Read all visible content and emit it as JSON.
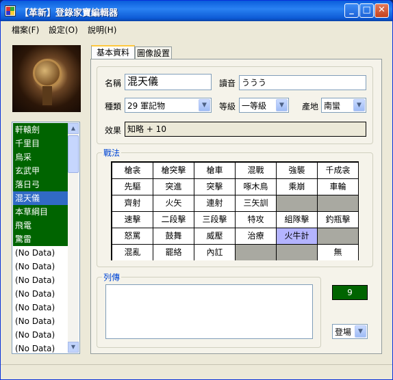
{
  "window": {
    "title": "【革新】登錄家寶編輯器"
  },
  "menu": [
    "檔案(F)",
    "設定(O)",
    "說明(H)"
  ],
  "list": {
    "items": [
      {
        "label": "軒轅劍",
        "style": "green"
      },
      {
        "label": "千里目",
        "style": "green"
      },
      {
        "label": "烏采",
        "style": "green"
      },
      {
        "label": "玄武甲",
        "style": "green"
      },
      {
        "label": "落日弓",
        "style": "green"
      },
      {
        "label": "混天儀",
        "style": "selected"
      },
      {
        "label": "本草綱目",
        "style": "green"
      },
      {
        "label": "飛電",
        "style": "green"
      },
      {
        "label": "驚雷",
        "style": "green"
      },
      {
        "label": "(No Data)",
        "style": "plain"
      },
      {
        "label": "(No Data)",
        "style": "plain"
      },
      {
        "label": "(No Data)",
        "style": "plain"
      },
      {
        "label": "(No Data)",
        "style": "plain"
      },
      {
        "label": "(No Data)",
        "style": "plain"
      },
      {
        "label": "(No Data)",
        "style": "plain"
      },
      {
        "label": "(No Data)",
        "style": "plain"
      },
      {
        "label": "(No Data)",
        "style": "plain"
      }
    ]
  },
  "tabs": [
    "基本資料",
    "圖像設置"
  ],
  "form": {
    "name_label": "名稱",
    "name_value": "混天儀",
    "reading_label": "讀音",
    "reading_value": "ううう",
    "type_label": "種類",
    "type_value": "29 軍記物",
    "grade_label": "等級",
    "grade_value": "一等級",
    "origin_label": "產地",
    "origin_value": "南蠻",
    "effect_label": "效果",
    "effect_value": "知略 + 10"
  },
  "tactics": {
    "label": "戰法",
    "rows": [
      [
        {
          "t": "槍衾"
        },
        {
          "t": "槍突擊"
        },
        {
          "t": "槍車"
        },
        {
          "t": "混戰"
        },
        {
          "t": "強襲"
        },
        {
          "t": "千成衾"
        }
      ],
      [
        {
          "t": "先驅"
        },
        {
          "t": "突進"
        },
        {
          "t": "突擊"
        },
        {
          "t": "啄木鳥"
        },
        {
          "t": "乘崩"
        },
        {
          "t": "車輪"
        }
      ],
      [
        {
          "t": "齊射"
        },
        {
          "t": "火矢"
        },
        {
          "t": "連射"
        },
        {
          "t": "三矢訓"
        },
        {
          "t": "",
          "s": "gray"
        },
        {
          "t": "",
          "s": "gray"
        }
      ],
      [
        {
          "t": "速擊"
        },
        {
          "t": "二段擊"
        },
        {
          "t": "三段擊"
        },
        {
          "t": "特攻"
        },
        {
          "t": "組隊擊"
        },
        {
          "t": "釣瓶擊"
        }
      ],
      [
        {
          "t": "怒罵"
        },
        {
          "t": "鼓舞"
        },
        {
          "t": "威壓"
        },
        {
          "t": "治療"
        },
        {
          "t": "火牛計",
          "s": "hl"
        },
        {
          "t": "",
          "s": "gray"
        }
      ],
      [
        {
          "t": "混亂"
        },
        {
          "t": "罷絡"
        },
        {
          "t": "內訌"
        },
        {
          "t": "",
          "s": "gray"
        },
        {
          "t": "",
          "s": "gray"
        },
        {
          "t": "無"
        }
      ]
    ]
  },
  "biography": {
    "label": "列傳",
    "text": ""
  },
  "counter": {
    "value": "9"
  },
  "appear": {
    "value": "登場"
  },
  "icons": {
    "dropdown": "chevron-down-icon",
    "minimize": "minimize-icon",
    "maximize": "maximize-icon",
    "close": "close-icon"
  },
  "colors": {
    "list_green": "#006400",
    "list_selected": "#316ac5",
    "tactic_highlight": "#b4b4ff",
    "tactic_disabled": "#a9a9a1",
    "group_label": "#0046d5"
  }
}
